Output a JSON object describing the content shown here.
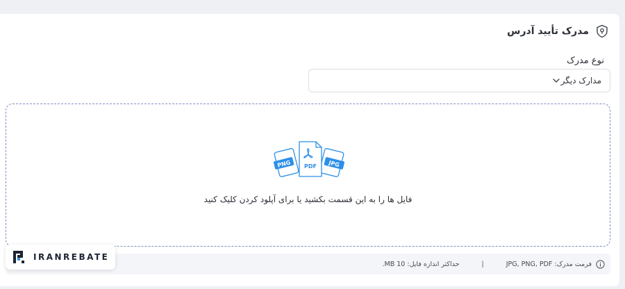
{
  "section": {
    "title": "مدرک تأیید آدرس",
    "icon": "location-shield-icon"
  },
  "document_type": {
    "label": "نوع مدرک",
    "selected": "مدارک دیگر"
  },
  "dropzone": {
    "text": "فایل ها را به این قسمت بکشید یا برای آپلود کردن کلیک کنید",
    "file_badges": [
      "PNG",
      "PDF",
      "JPG"
    ]
  },
  "info": {
    "format": "فرمت مدرک: JPG, PNG, PDF",
    "separator": "|",
    "max_size": "حداکثر اندازه فایل: 10 MB."
  },
  "brand": {
    "name": "IRANREBATE"
  },
  "colors": {
    "accent": "#2e8fe8",
    "dashed_border": "#7e8cc0"
  }
}
